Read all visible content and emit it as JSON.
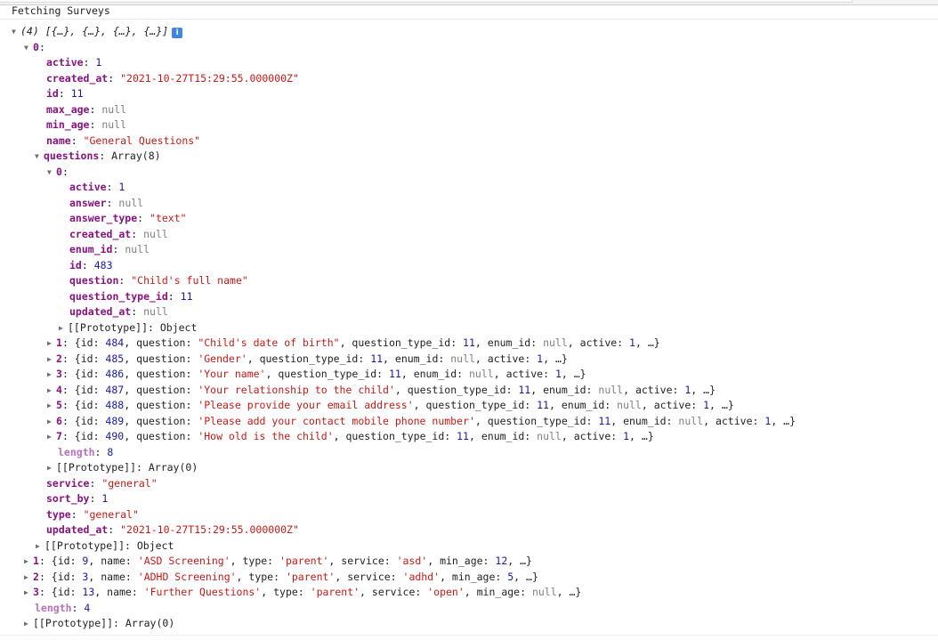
{
  "window": {
    "message_label": "Fetching Surveys"
  },
  "root": {
    "summary": "(4) [{…}, {…}, {…}, {…}]",
    "info_icon": "i",
    "item0": {
      "index": "0",
      "fields": [
        {
          "key": "active",
          "value": "1",
          "kind": "num"
        },
        {
          "key": "created_at",
          "value": "\"2021-10-27T15:29:55.000000Z\"",
          "kind": "str"
        },
        {
          "key": "id",
          "value": "11",
          "kind": "num"
        },
        {
          "key": "max_age",
          "value": "null",
          "kind": "nul"
        },
        {
          "key": "min_age",
          "value": "null",
          "kind": "nul"
        },
        {
          "key": "name",
          "value": "\"General Questions\"",
          "kind": "str"
        }
      ],
      "questions": {
        "key": "questions",
        "summary": "Array(8)",
        "q0": {
          "index": "0",
          "fields": [
            {
              "key": "active",
              "value": "1",
              "kind": "num"
            },
            {
              "key": "answer",
              "value": "null",
              "kind": "nul"
            },
            {
              "key": "answer_type",
              "value": "\"text\"",
              "kind": "str"
            },
            {
              "key": "created_at",
              "value": "null",
              "kind": "nul"
            },
            {
              "key": "enum_id",
              "value": "null",
              "kind": "nul"
            },
            {
              "key": "id",
              "value": "483",
              "kind": "num"
            },
            {
              "key": "question",
              "value": "\"Child's full name\"",
              "kind": "str"
            },
            {
              "key": "question_type_id",
              "value": "11",
              "kind": "num"
            },
            {
              "key": "updated_at",
              "value": "null",
              "kind": "nul"
            }
          ],
          "prototype": "[[Prototype]]: Object"
        },
        "collapsed": [
          {
            "index": "1",
            "id": "484",
            "question": "\"Child's date of birth\"",
            "qtid": "11",
            "enum_id": "null",
            "active": "1"
          },
          {
            "index": "2",
            "id": "485",
            "question": "'Gender'",
            "qtid": "11",
            "enum_id": "null",
            "active": "1"
          },
          {
            "index": "3",
            "id": "486",
            "question": "'Your name'",
            "qtid": "11",
            "enum_id": "null",
            "active": "1"
          },
          {
            "index": "4",
            "id": "487",
            "question": "'Your relationship to the child'",
            "qtid": "11",
            "enum_id": "null",
            "active": "1"
          },
          {
            "index": "5",
            "id": "488",
            "question": "'Please provide your email address'",
            "qtid": "11",
            "enum_id": "null",
            "active": "1"
          },
          {
            "index": "6",
            "id": "489",
            "question": "'Please add your contact mobile phone number'",
            "qtid": "11",
            "enum_id": "null",
            "active": "1"
          },
          {
            "index": "7",
            "id": "490",
            "question": "'How old is the child'",
            "qtid": "11",
            "enum_id": "null",
            "active": "1"
          }
        ],
        "length_key": "length",
        "length_value": "8",
        "prototype": "[[Prototype]]: Array(0)"
      },
      "fields_after": [
        {
          "key": "service",
          "value": "\"general\"",
          "kind": "str"
        },
        {
          "key": "sort_by",
          "value": "1",
          "kind": "num"
        },
        {
          "key": "type",
          "value": "\"general\"",
          "kind": "str"
        },
        {
          "key": "updated_at",
          "value": "\"2021-10-27T15:29:55.000000Z\"",
          "kind": "str"
        }
      ],
      "prototype": "[[Prototype]]: Object"
    },
    "collapsed": [
      {
        "index": "1",
        "id": "9",
        "name": "'ASD Screening'",
        "type": "'parent'",
        "service": "'asd'",
        "min_age": "12",
        "min_age_kind": "num"
      },
      {
        "index": "2",
        "id": "3",
        "name": "'ADHD Screening'",
        "type": "'parent'",
        "service": "'adhd'",
        "min_age": "5",
        "min_age_kind": "num"
      },
      {
        "index": "3",
        "id": "13",
        "name": "'Further Questions'",
        "type": "'parent'",
        "service": "'open'",
        "min_age": "null",
        "min_age_kind": "nul"
      }
    ],
    "length_key": "length",
    "length_value": "4",
    "prototype": "[[Prototype]]: Array(0)"
  },
  "labels": {
    "id": "id",
    "question": "question",
    "question_type_id": "question_type_id",
    "enum_id": "enum_id",
    "active": "active",
    "name": "name",
    "type": "type",
    "service": "service",
    "min_age": "min_age",
    "ellipsis": "…"
  }
}
